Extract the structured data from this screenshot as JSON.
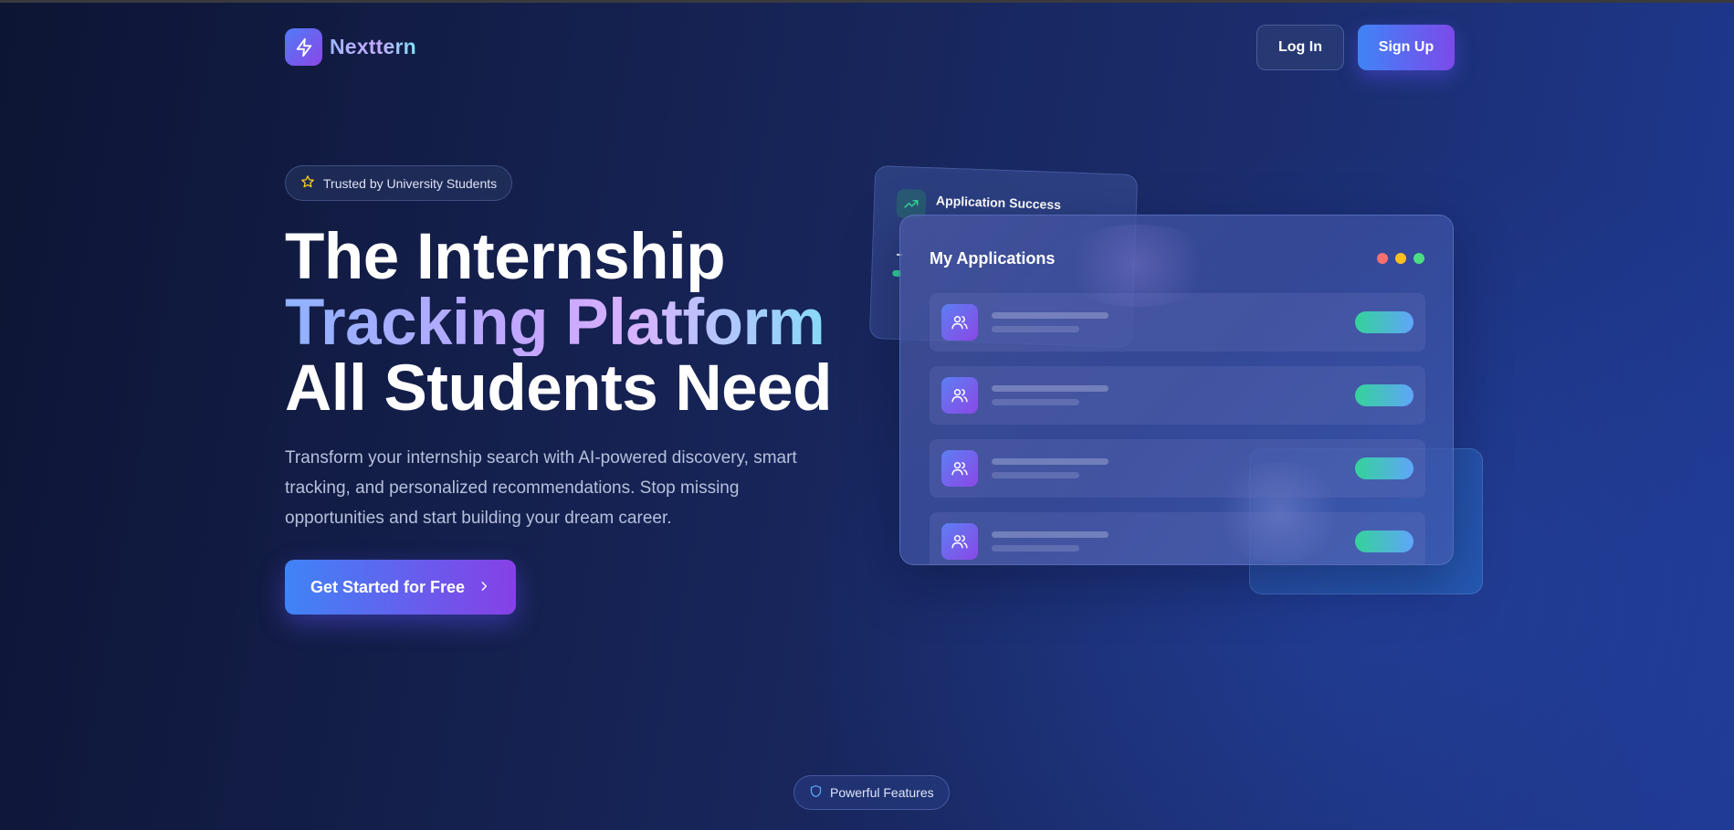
{
  "header": {
    "logo_text": "Nexttern",
    "login_label": "Log In",
    "signup_label": "Sign Up"
  },
  "hero": {
    "badge_label": "Trusted by University Students",
    "title_line1": "The Internship",
    "title_line2": "Tracking Platform",
    "title_line3": "All Students Need",
    "subtitle": "Transform your internship search with AI-powered discovery, smart tracking, and personalized recommendations. Stop missing opportunities and start building your dream career.",
    "cta_label": "Get Started for Free"
  },
  "illustration": {
    "back_card_title": "Application Success",
    "main_card_title": "My Applications",
    "window_dots": [
      "#f87171",
      "#fbbf24",
      "#4ade80"
    ],
    "row_count": 4
  },
  "features_badge_label": "Powerful Features",
  "colors": {
    "accent_blue": "#3f84f6",
    "accent_purple": "#8640e6",
    "status_green": "#34d399"
  },
  "icons": {
    "logo": "lightning-bolt-icon",
    "badge": "star-icon",
    "cta": "chevron-right-icon",
    "back_card": "trending-up-icon",
    "row_avatar": "users-icon",
    "features": "shield-icon"
  }
}
